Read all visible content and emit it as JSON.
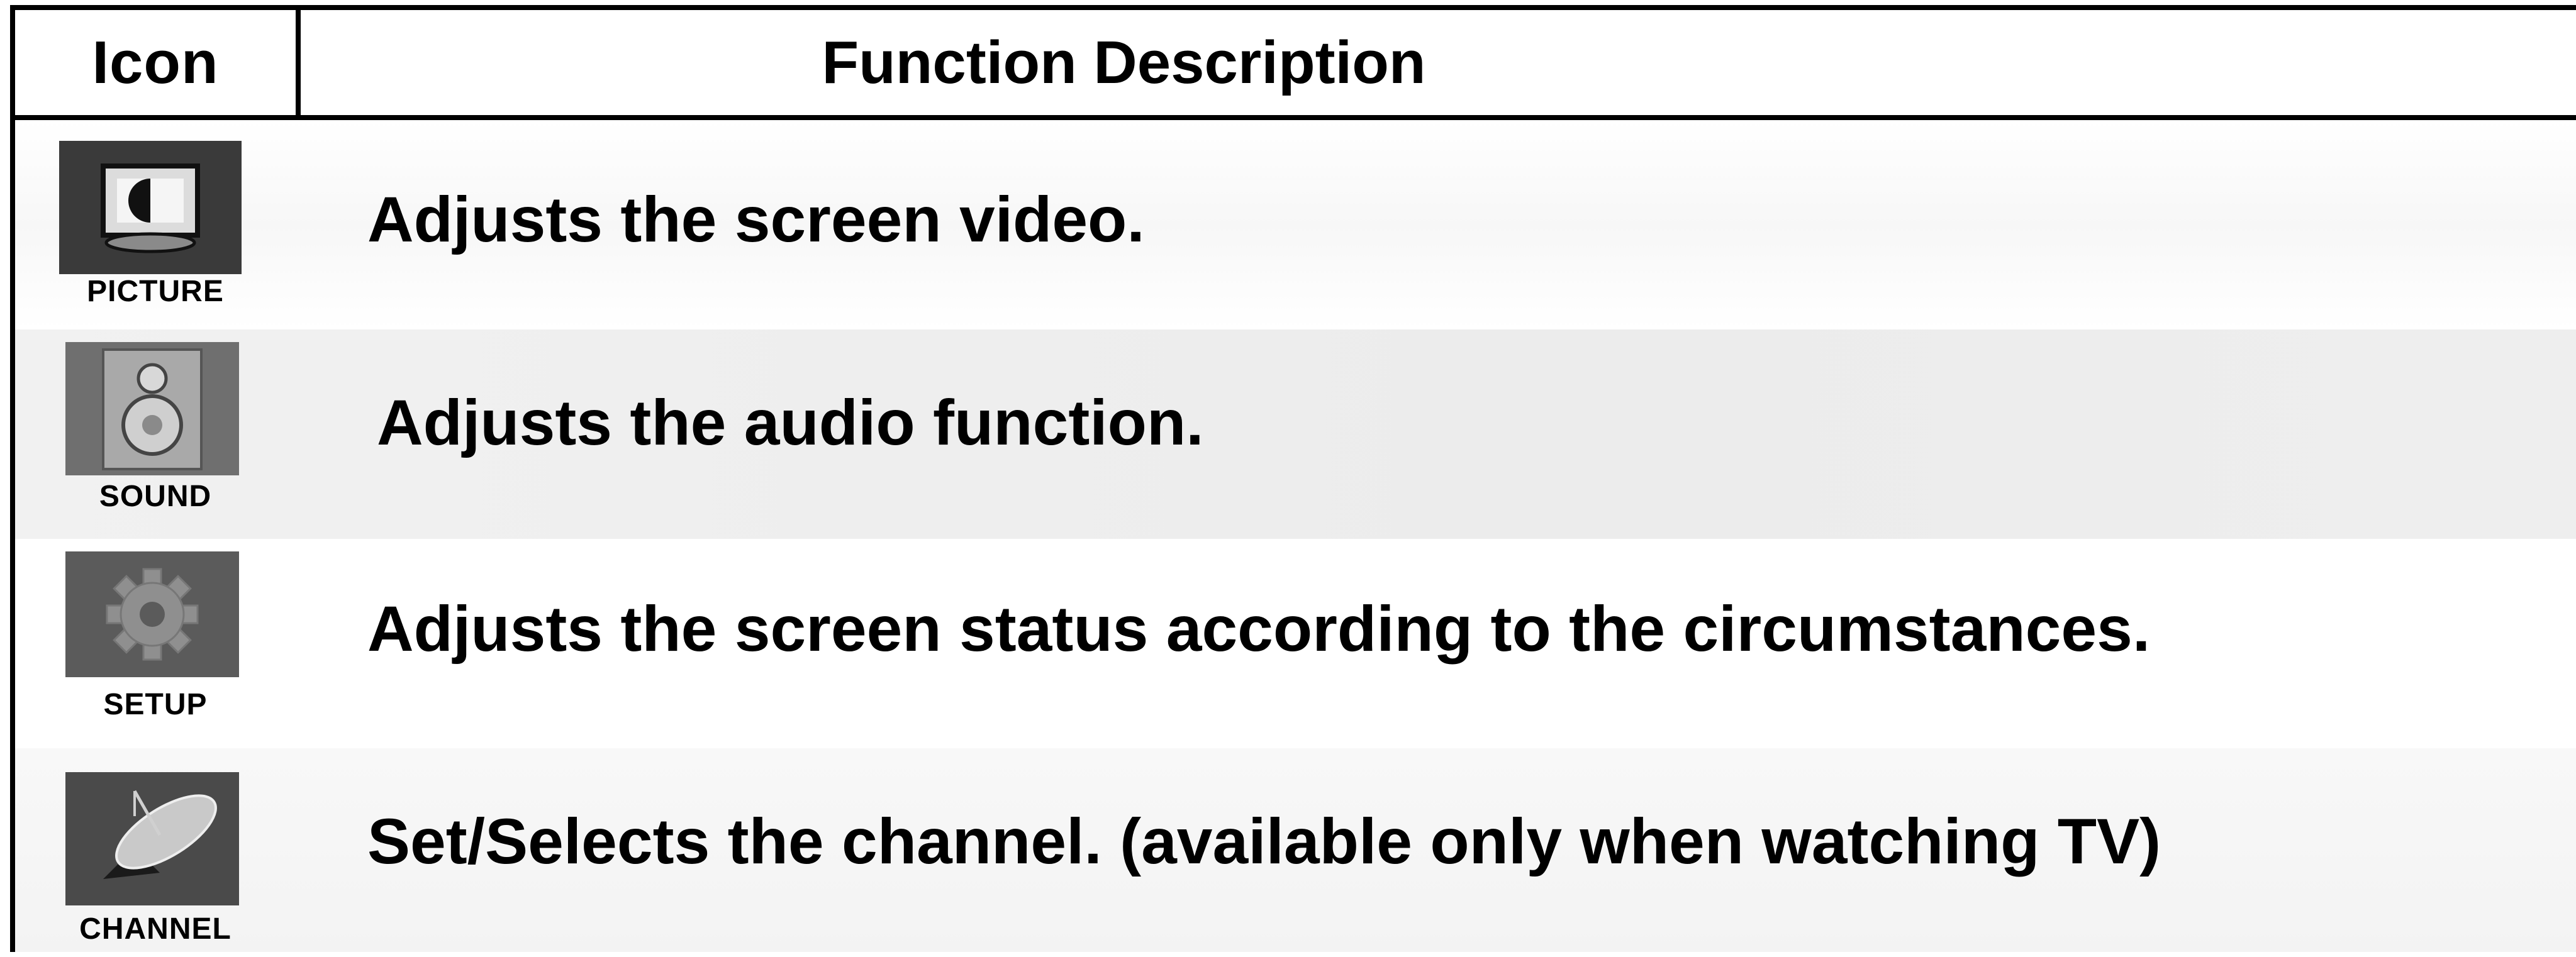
{
  "header": {
    "icon_col": "Icon",
    "desc_col": "Function Description"
  },
  "rows": [
    {
      "icon": "picture-icon",
      "label": "PICTURE",
      "description": "Adjusts the screen video."
    },
    {
      "icon": "sound-icon",
      "label": "SOUND",
      "description": "Adjusts the audio function."
    },
    {
      "icon": "setup-icon",
      "label": "SETUP",
      "description": "Adjusts the screen status according to the circumstances."
    },
    {
      "icon": "channel-icon",
      "label": "CHANNEL",
      "description": "Set/Selects the channel. (available only when watching TV)"
    }
  ]
}
